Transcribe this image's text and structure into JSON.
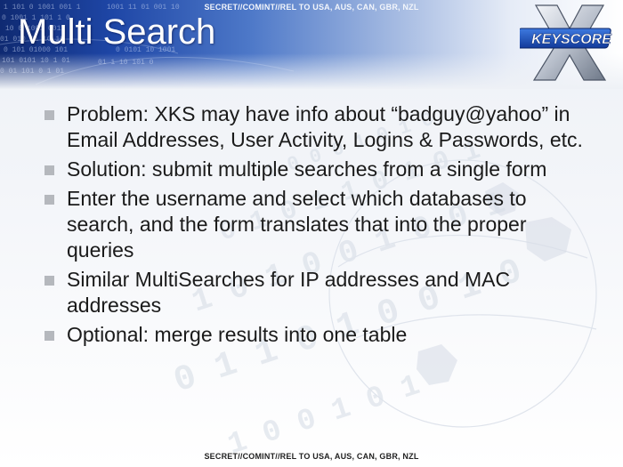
{
  "classification": {
    "top": "SECRET//COMINT//REL TO USA, AUS, CAN, GBR, NZL",
    "bottom": "SECRET//COMINT//REL TO USA, AUS, CAN, GBR, NZL"
  },
  "title": "Multi Search",
  "logo": {
    "text": "KEYSCORE",
    "icon": "x-logo"
  },
  "bullets": [
    "Problem: XKS may have info about “badguy@yahoo” in Email Addresses, User Activity, Logins & Passwords, etc.",
    "Solution: submit multiple searches from a single form",
    "Enter the username and select which databases to search, and the form translates that into the proper queries",
    "Similar MultiSearches for IP addresses and MAC addresses",
    "Optional: merge results into one table"
  ],
  "colors": {
    "header_dark": "#0f2a72",
    "header_mid": "#4d78c8",
    "bullet_marker": "#b5b8bd",
    "body_text": "#1a1a1a"
  }
}
